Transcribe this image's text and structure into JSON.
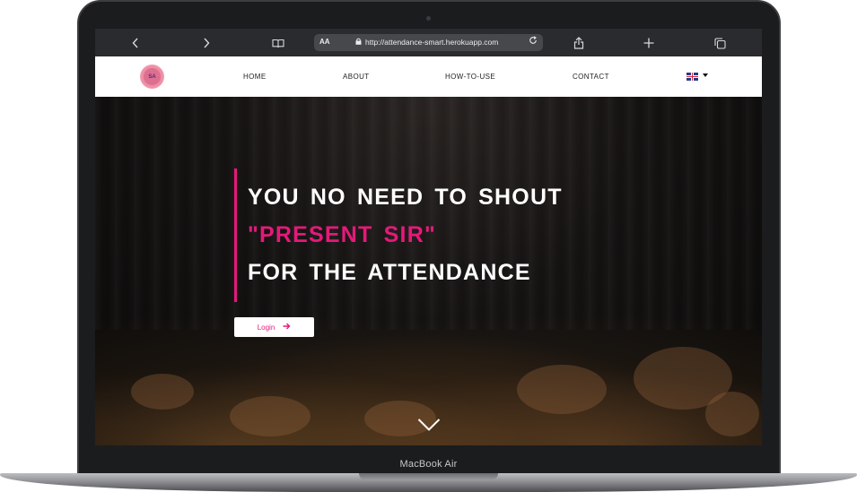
{
  "device": {
    "label": "MacBook Air"
  },
  "browser": {
    "text_size_label": "AA",
    "url": "http://attendance-smart.herokuapp.com"
  },
  "site": {
    "logo_text": "SA",
    "nav": [
      {
        "label": "HOME"
      },
      {
        "label": "ABOUT"
      },
      {
        "label": "HOW-TO-USE"
      },
      {
        "label": "CONTACT"
      }
    ],
    "language": "en-gb-flag-icon"
  },
  "hero": {
    "line1": "YOU NO NEED TO SHOUT",
    "line2": "\"PRESENT SIR\"",
    "line3": "FOR THE ATTENDANCE",
    "login_label": "Login",
    "accent_color": "#e5197a"
  }
}
